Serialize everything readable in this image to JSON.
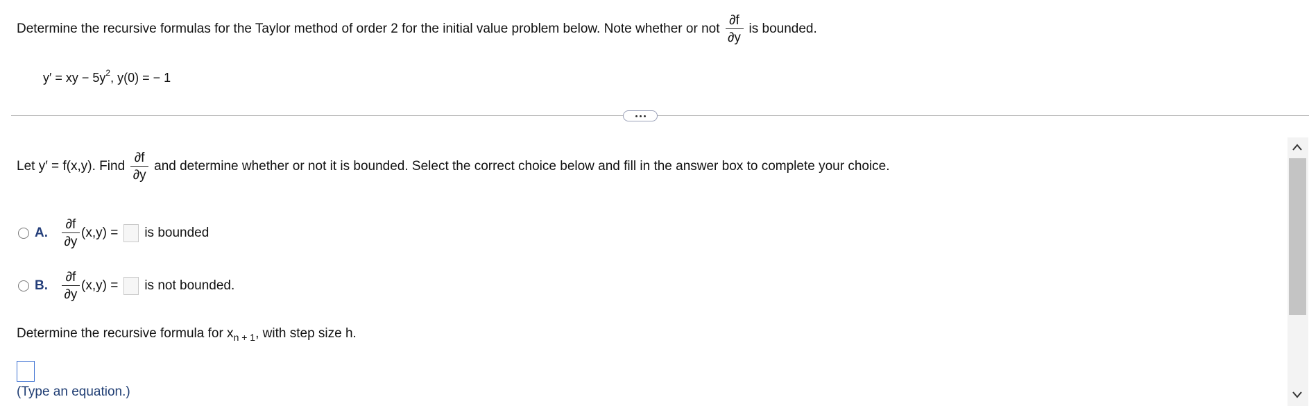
{
  "question": {
    "prompt_start": "Determine the recursive formulas for the Taylor method of order 2 for the initial value problem below. Note whether or not",
    "prompt_end": "is bounded.",
    "partial_num": "∂f",
    "partial_den": "∂y",
    "ivp": {
      "lhs": "y′ = xy − 5y",
      "exp": "2",
      "rhs": ", y(0) = − 1"
    }
  },
  "more_button_label": "more",
  "part1": {
    "intro_start": "Let y′ = f(x,y). Find",
    "intro_end": "and determine whether or not it is bounded. Select the correct choice below and fill in the answer box to complete your choice.",
    "choices": [
      {
        "letter": "A.",
        "expr": "(x,y) =",
        "suffix": "is bounded"
      },
      {
        "letter": "B.",
        "expr": "(x,y) =",
        "suffix": "is not bounded."
      }
    ]
  },
  "part2": {
    "prompt_start": "Determine the recursive formula for x",
    "subscript": "n + 1",
    "prompt_end": ", with step size h.",
    "hint": "(Type an equation.)"
  },
  "scroll": {
    "up_icon": "chevron-up-icon",
    "down_icon": "chevron-down-icon"
  }
}
